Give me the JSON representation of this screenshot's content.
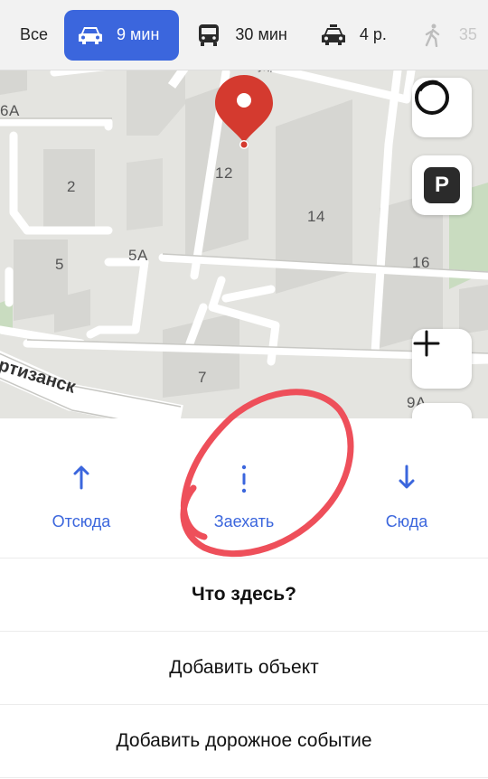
{
  "transport_tabs": [
    {
      "id": "all",
      "label": "Все",
      "icon": "none"
    },
    {
      "id": "car",
      "label": "9 мин",
      "icon": "car-icon",
      "active": true
    },
    {
      "id": "bus",
      "label": "30 мин",
      "icon": "bus-icon"
    },
    {
      "id": "taxi",
      "label": "4 р.",
      "icon": "taxi-icon"
    },
    {
      "id": "walk",
      "label": "35",
      "icon": "walk-icon"
    }
  ],
  "map": {
    "house_numbers": [
      "6А",
      "2",
      "12",
      "14",
      "5",
      "5А",
      "16",
      "7",
      "9А"
    ],
    "street_main": "ртизанск",
    "street_top": "ул.",
    "buttons": {
      "parking_label": "P",
      "zoom_in_label": "+"
    }
  },
  "actions": {
    "from": "Отсюда",
    "via": "Заехать",
    "to": "Сюда"
  },
  "menu": {
    "whats_here": "Что здесь?",
    "add_object": "Добавить объект",
    "add_road_event": "Добавить дорожное событие"
  },
  "colors": {
    "accent": "#3b66dd",
    "pin": "#d43a2f",
    "annotation": "#ee4f5a"
  }
}
